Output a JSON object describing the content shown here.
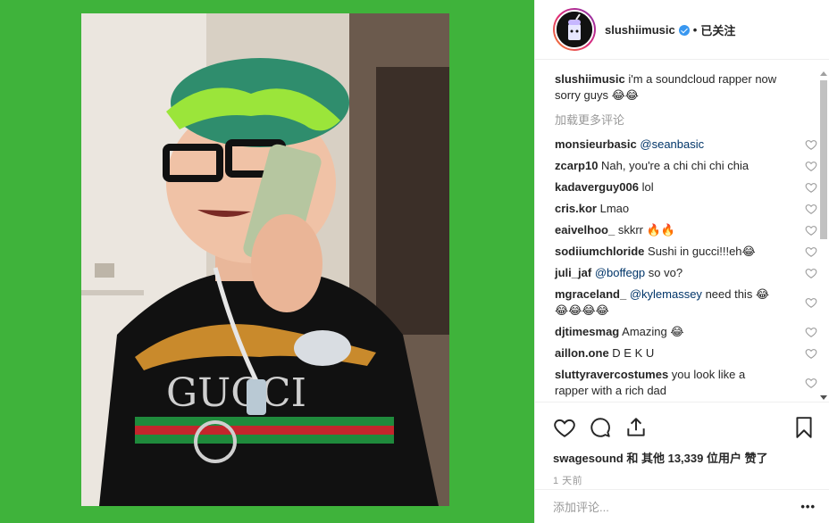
{
  "header": {
    "username": "slushiimusic",
    "follow_status": "已关注",
    "separator": "•"
  },
  "caption": {
    "username": "slushiimusic",
    "text": "i'm a soundcloud rapper now sorry guys 😂😂"
  },
  "load_more_label": "加载更多评论",
  "comments": [
    {
      "user": "monsieurbasic",
      "mention": "@seanbasic",
      "text": ""
    },
    {
      "user": "zcarp10",
      "mention": "",
      "text": "Nah, you're a chi chi chi chia"
    },
    {
      "user": "kadaverguy006",
      "mention": "",
      "text": "lol"
    },
    {
      "user": "cris.kor",
      "mention": "",
      "text": "Lmao"
    },
    {
      "user": "eaivelhoo_",
      "mention": "",
      "text": "skkrr 🔥🔥"
    },
    {
      "user": "sodiiumchloride",
      "mention": "",
      "text": "Sushi in gucci!!!eh😂"
    },
    {
      "user": "juli_jaf",
      "mention": "@boffegp",
      "text": "so vo?"
    },
    {
      "user": "mgraceland_",
      "mention": "@kylemassey",
      "text": "need this 😂😂😂😂😂"
    },
    {
      "user": "djtimesmag",
      "mention": "",
      "text": "Amazing 😂"
    },
    {
      "user": "aillon.one",
      "mention": "",
      "text": "D E K U"
    },
    {
      "user": "sluttyravercostumes",
      "mention": "",
      "text": "you look like a rapper with a rich dad"
    }
  ],
  "likes": {
    "prefix_user": "swagesound",
    "text": "和 其他 13,339 位用户 赞了"
  },
  "timestamp": "1 天前",
  "add_comment_placeholder": "添加评论...",
  "more_label": "•••",
  "colors": {
    "background_green": "#3fb33b",
    "link": "#003569",
    "verified": "#3897f0",
    "muted": "#999999"
  },
  "icons": [
    "heart-icon",
    "comment-icon",
    "share-icon",
    "bookmark-icon",
    "verified-badge-icon"
  ]
}
